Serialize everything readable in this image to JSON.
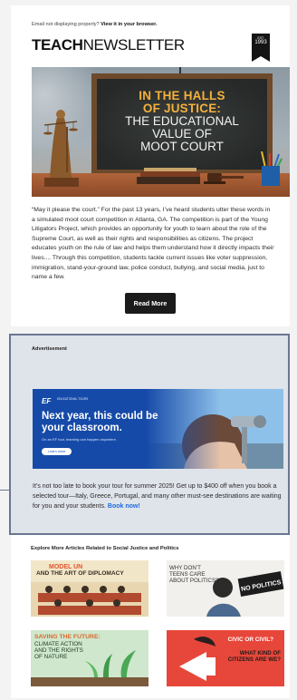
{
  "preheader": {
    "text": "Email not displaying properly?",
    "link": "View it in your browser."
  },
  "brand": {
    "bold": "TEACH",
    "light": "NEWSLETTER",
    "badge_est": "EST.",
    "badge_year": "1993"
  },
  "hero": {
    "line1": "IN THE HALLS",
    "line2": "OF JUSTICE:",
    "line3": "THE EDUCATIONAL",
    "line4": "VALUE OF",
    "line5": "MOOT COURT"
  },
  "article": {
    "body": "“May it please the court.” For the past 13 years, I’ve heard students utter these words in a simulated moot court competition in Atlanta, GA. The competition is part of the Young Litigators Project, which provides an opportunity for youth to learn about the role of the Supreme Court, as well as their rights and responsibilities as citizens. The project educates youth on the rule of law and helps them understand how it directly impacts their lives.... Through this competition, students tackle current issues like voter suppression, immigration, stand-your-ground law, police conduct, bullying, and social media, just to name a few.",
    "read_more": "Read More"
  },
  "ad": {
    "label": "Advertisement",
    "brand": "EF",
    "brand_tag": "EDUCATIONAL TOURS",
    "headline": "Next year, this could be your classroom.",
    "subline": "On an EF tour, learning can happen anywhere.",
    "cta": "Learn more",
    "copy": "It’s not too late to book your tour for summer 2025! Get up to $400 off when you book a selected tour—Italy, Greece, Portugal, and many other must-see destinations are waiting for you and your students.",
    "link": "Book now!"
  },
  "explore": {
    "title": "Explore More Articles Related to Social Justice and Politics",
    "tiles": [
      {
        "a": "MODEL UN",
        "b": "AND THE ART OF DIPLOMACY"
      },
      {
        "a": "WHY DON’T TEENS CARE ABOUT POLITICS?",
        "sign": "NO POLITICS"
      },
      {
        "a": "SAVING THE FUTURE:",
        "b": "CLIMATE ACTION AND THE RIGHTS OF NATURE"
      },
      {
        "a": "CIVIC OR CIVIL?",
        "b": "WHAT KIND OF CITIZENS ARE WE?"
      }
    ]
  }
}
